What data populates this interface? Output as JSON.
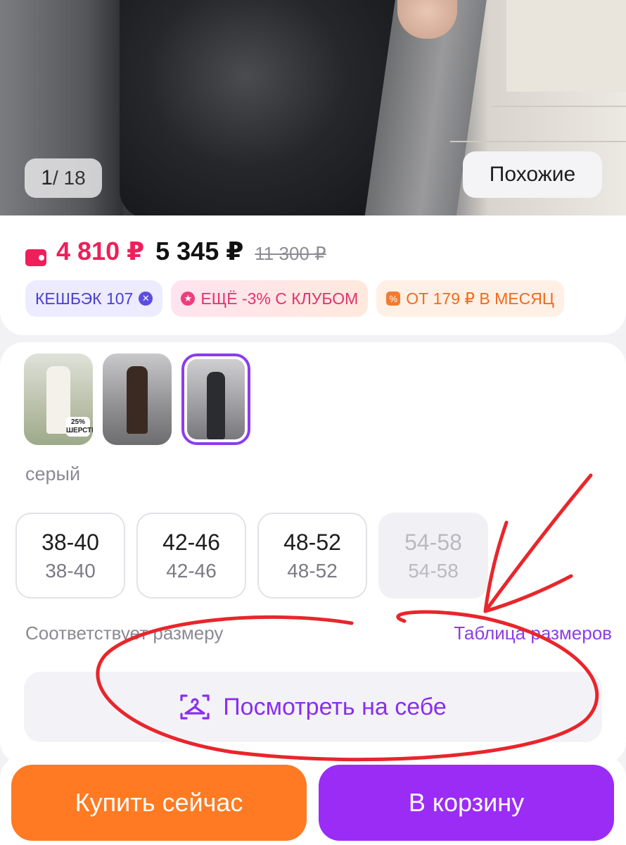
{
  "gallery": {
    "counter_current": "1",
    "counter_total": "/ 18",
    "similar_label": "Похожие"
  },
  "price": {
    "wallet_price": "4 810 ₽",
    "regular_price": "5 345 ₽",
    "old_price": "11 300 ₽"
  },
  "badges": {
    "cashback": "КЕШБЭК 107",
    "club": "ЕЩЁ -3% С КЛУБОМ",
    "installment": "ОТ 179 ₽ В МЕСЯЦ"
  },
  "variants": {
    "wool_tag": "25% ШЕРСТИ",
    "selected_color": "серый"
  },
  "sizes": [
    {
      "ru": "38-40",
      "intl": "38-40",
      "available": true
    },
    {
      "ru": "42-46",
      "intl": "42-46",
      "available": true
    },
    {
      "ru": "48-52",
      "intl": "48-52",
      "available": true
    },
    {
      "ru": "54-58",
      "intl": "54-58",
      "available": false
    }
  ],
  "fit": {
    "fit_text": "Соответствует размеру",
    "size_table_link": "Таблица размеров"
  },
  "try_on": {
    "label": "Посмотреть на себе"
  },
  "actions": {
    "buy_now": "Купить сейчас",
    "add_to_cart": "В корзину"
  },
  "colors": {
    "accent_purple": "#9b2cf5",
    "accent_orange": "#ff7a22",
    "price_red": "#ee1f5a",
    "annotation_red": "#e8262b"
  }
}
